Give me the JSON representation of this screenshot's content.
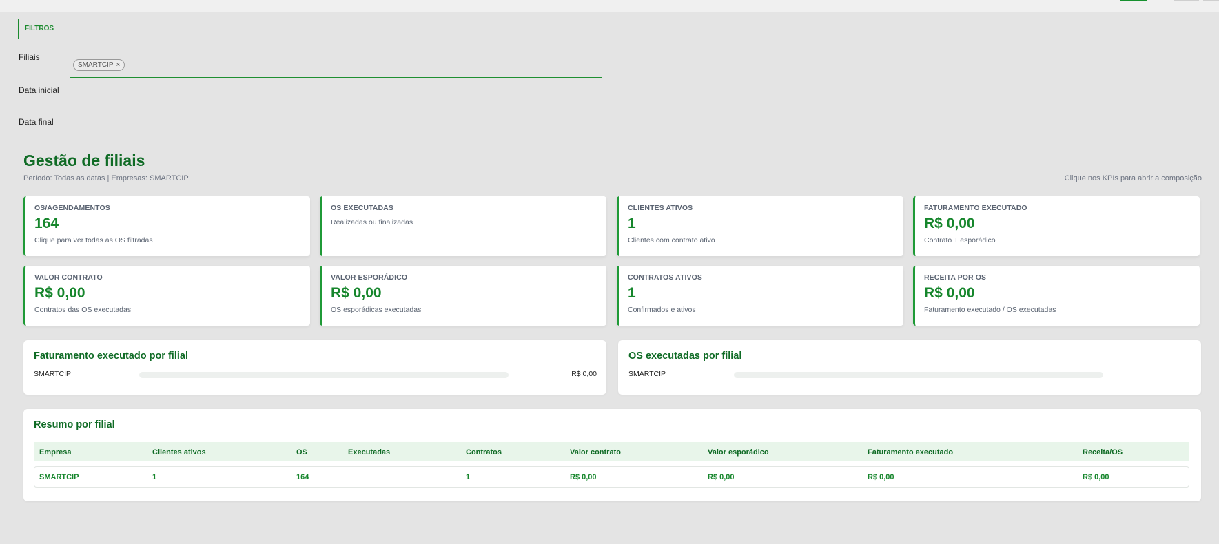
{
  "filters": {
    "header": "FILTROS",
    "filiais_label": "Filiais",
    "selected_chip": "SMARTCIP",
    "chip_remove": "×",
    "data_inicial_label": "Data inicial",
    "data_final_label": "Data final"
  },
  "page": {
    "title": "Gestão de filiais",
    "subtitle": "Período: Todas as datas | Empresas: SMARTCIP",
    "hint": "Clique nos KPIs para abrir a composição"
  },
  "kpis": [
    {
      "label": "OS/AGENDAMENTOS",
      "value": "164",
      "sub": "Clique para ver todas as OS filtradas"
    },
    {
      "label": "OS EXECUTADAS",
      "value": "",
      "sub": "Realizadas ou finalizadas"
    },
    {
      "label": "CLIENTES ATIVOS",
      "value": "1",
      "sub": "Clientes com contrato ativo"
    },
    {
      "label": "FATURAMENTO EXECUTADO",
      "value": "R$ 0,00",
      "sub": "Contrato + esporádico"
    },
    {
      "label": "VALOR CONTRATO",
      "value": "R$ 0,00",
      "sub": "Contratos das OS executadas"
    },
    {
      "label": "VALOR ESPORÁDICO",
      "value": "R$ 0,00",
      "sub": "OS esporádicas executadas"
    },
    {
      "label": "CONTRATOS ATIVOS",
      "value": "1",
      "sub": "Confirmados e ativos"
    },
    {
      "label": "RECEITA POR OS",
      "value": "R$ 0,00",
      "sub": "Faturamento executado / OS executadas"
    }
  ],
  "faturamento_panel": {
    "title": "Faturamento executado por filial",
    "rows": [
      {
        "name": "SMARTCIP",
        "value": "R$ 0,00",
        "fraction": 0
      }
    ]
  },
  "os_panel": {
    "title": "OS executadas por filial",
    "rows": [
      {
        "name": "SMARTCIP",
        "value": "",
        "fraction": 0
      }
    ]
  },
  "summary": {
    "title": "Resumo por filial",
    "columns": [
      "Empresa",
      "Clientes ativos",
      "OS",
      "Executadas",
      "Contratos",
      "Valor contrato",
      "Valor esporádico",
      "Faturamento executado",
      "Receita/OS"
    ],
    "rows": [
      [
        "SMARTCIP",
        "1",
        "164",
        "",
        "1",
        "R$ 0,00",
        "R$ 0,00",
        "R$ 0,00",
        "R$ 0,00"
      ]
    ]
  },
  "colors": {
    "accent": "#1f9a37",
    "title": "#0f6b25",
    "background": "#e4e4e4"
  }
}
